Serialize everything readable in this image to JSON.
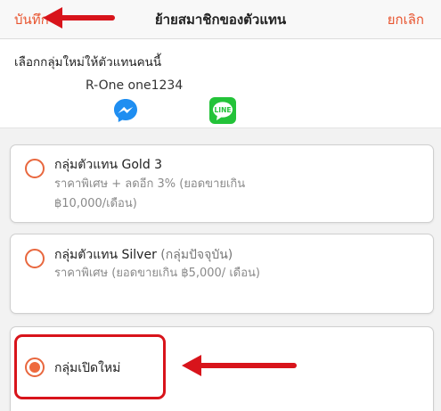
{
  "header": {
    "save_label": "บันทึก",
    "title": "ย้ายสมาชิกของตัวแทน",
    "cancel_label": "ยกเลิก"
  },
  "member": {
    "prompt": "เลือกกลุ่มใหม่ให้ตัวแทนคนนี้",
    "name": "R-One one1234",
    "contact_icons": [
      "messenger-icon",
      "line-icon"
    ]
  },
  "groups": [
    {
      "title": "กลุ่มตัวแทน Gold 3",
      "suffix": "",
      "description": "ราคาพิเศษ + ลดอีก 3% (ยอดขายเกิน ฿10,000/เดือน)",
      "selected": false
    },
    {
      "title": "กลุ่มตัวแทน Silver",
      "suffix": "(กลุ่มปัจจุบัน)",
      "description": "ราคาพิเศษ (ยอดขายเกิน ฿5,000/ เดือน)",
      "selected": false
    },
    {
      "title": "กลุ่มเปิดใหม่",
      "suffix": "",
      "description": "",
      "selected": true
    }
  ],
  "colors": {
    "accent": "#e8542f",
    "radio": "#ee6a3e",
    "annotation": "#d8141b",
    "messenger": "#1f8ef1",
    "line": "#23c339"
  }
}
